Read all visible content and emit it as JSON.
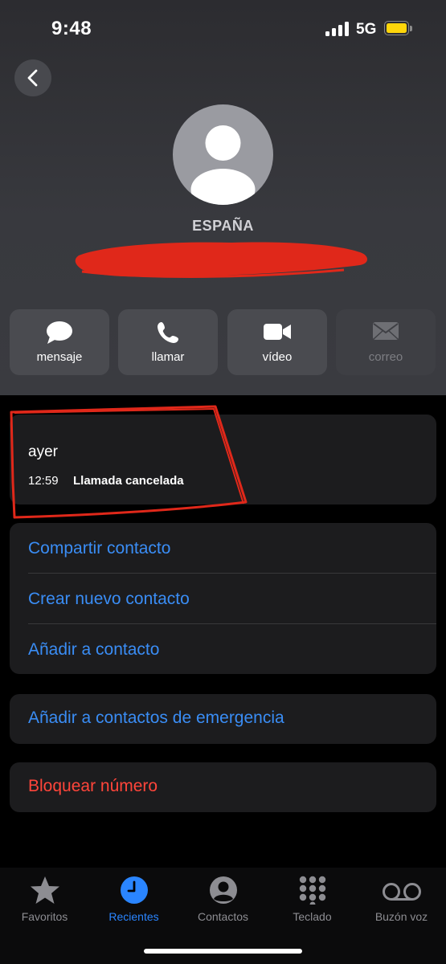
{
  "status_bar": {
    "time": "9:48",
    "network": "5G",
    "battery_color": "#ffd60a"
  },
  "contact": {
    "name": "ESPAÑA",
    "number_redacted": true
  },
  "actions": [
    {
      "label": "mensaje",
      "icon": "message-bubble-icon",
      "enabled": true
    },
    {
      "label": "llamar",
      "icon": "phone-icon",
      "enabled": true
    },
    {
      "label": "vídeo",
      "icon": "video-camera-icon",
      "enabled": true
    },
    {
      "label": "correo",
      "icon": "mail-envelope-icon",
      "enabled": false
    }
  ],
  "call_history": {
    "day": "ayer",
    "time": "12:59",
    "status": "Llamada cancelada"
  },
  "options": {
    "share": "Compartir contacto",
    "create_new": "Crear nuevo contacto",
    "add_existing": "Añadir a contacto",
    "emergency": "Añadir a contactos de emergencia",
    "block": "Bloquear número"
  },
  "tabs": [
    {
      "label": "Favoritos",
      "icon": "star-icon",
      "active": false
    },
    {
      "label": "Recientes",
      "icon": "clock-icon",
      "active": true
    },
    {
      "label": "Contactos",
      "icon": "person-circle-icon",
      "active": false
    },
    {
      "label": "Teclado",
      "icon": "keypad-icon",
      "active": false
    },
    {
      "label": "Buzón voz",
      "icon": "voicemail-icon",
      "active": false
    }
  ],
  "colors": {
    "accent": "#2a85ff",
    "link": "#3a8df5",
    "destructive": "#ff453a",
    "annotation": "#e0281a"
  }
}
